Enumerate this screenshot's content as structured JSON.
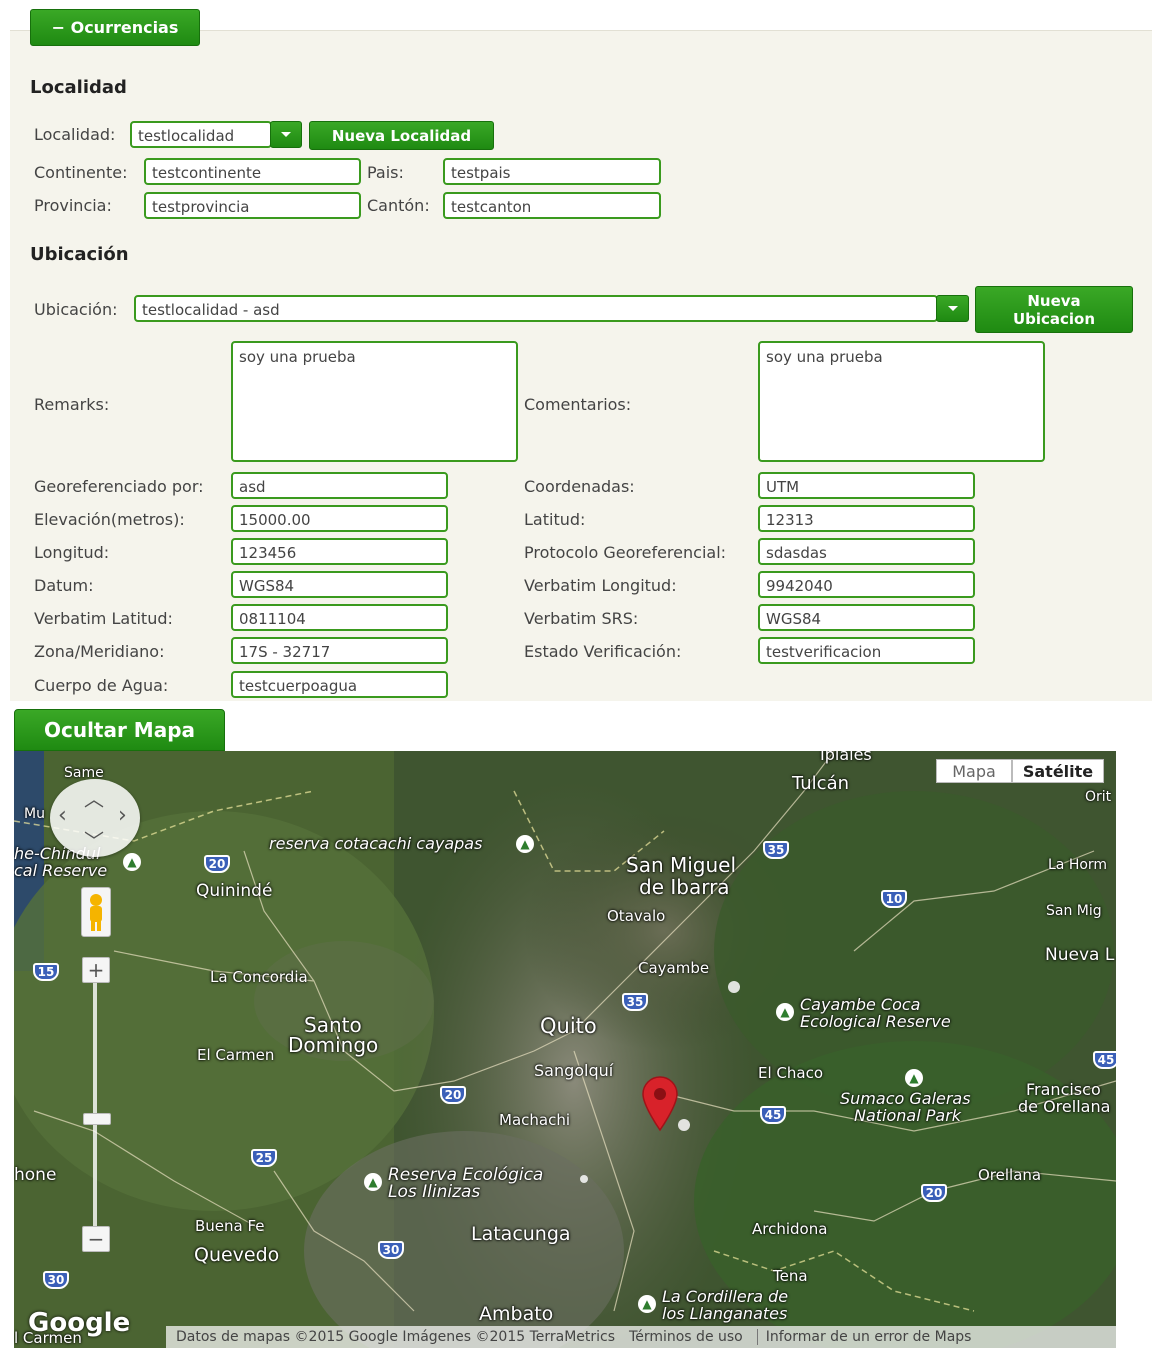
{
  "panel": {
    "toggle_label": "− Ocurrencias"
  },
  "localidad": {
    "title": "Localidad",
    "localidad_label": "Localidad:",
    "localidad_value": "testlocalidad",
    "nueva_localidad_button": "Nueva Localidad",
    "continente_label": "Continente:",
    "continente_value": "testcontinente",
    "pais_label": "Pais:",
    "pais_value": "testpais",
    "provincia_label": "Provincia:",
    "provincia_value": "testprovincia",
    "canton_label": "Cantón:",
    "canton_value": "testcanton"
  },
  "ubicacion": {
    "title": "Ubicación",
    "ubicacion_label": "Ubicación:",
    "ubicacion_value": "testlocalidad - asd",
    "nueva_ubicacion_button_line1": "Nueva",
    "nueva_ubicacion_button_line2": "Ubicacion",
    "remarks_label": "Remarks:",
    "remarks_value": "soy una prueba",
    "comentarios_label": "Comentarios:",
    "comentarios_value": "soy una prueba",
    "left_fields": [
      {
        "label": "Georeferenciado por:",
        "value": "asd"
      },
      {
        "label": "Elevación(metros):",
        "value": "15000.00"
      },
      {
        "label": "Longitud:",
        "value": "123456"
      },
      {
        "label": "Datum:",
        "value": "WGS84"
      },
      {
        "label": "Verbatim Latitud:",
        "value": "0811104"
      },
      {
        "label": "Zona/Meridiano:",
        "value": "17S - 32717"
      },
      {
        "label": "Cuerpo de Agua:",
        "value": "testcuerpoagua"
      }
    ],
    "right_fields": [
      {
        "label": "Coordenadas:",
        "value": "UTM"
      },
      {
        "label": "Latitud:",
        "value": "12313"
      },
      {
        "label": "Protocolo Georeferencial:",
        "value": "sdasdas"
      },
      {
        "label": "Verbatim Longitud:",
        "value": "9942040"
      },
      {
        "label": "Verbatim SRS:",
        "value": "WGS84"
      },
      {
        "label": "Estado Verificación:",
        "value": "testverificacion"
      }
    ]
  },
  "map": {
    "toggle_button": "Ocultar Mapa",
    "type_map": "Mapa",
    "type_satellite": "Satélite",
    "places": [
      {
        "text": "Ipiales"
      },
      {
        "text": "Tulcán"
      },
      {
        "text": "Same"
      },
      {
        "text": "Mu"
      },
      {
        "text": "Orit"
      },
      {
        "text": "reserva cotacachi cayapas"
      },
      {
        "text": "he-Chindul"
      },
      {
        "text": "cal Reserve"
      },
      {
        "text": "Quinindé"
      },
      {
        "text": "San Miguel"
      },
      {
        "text": "de Ibarra"
      },
      {
        "text": "La Horm"
      },
      {
        "text": "San Mig"
      },
      {
        "text": "Otavalo"
      },
      {
        "text": "Nueva L"
      },
      {
        "text": "Cayambe"
      },
      {
        "text": "La Concordia"
      },
      {
        "text": "Cayambe Coca"
      },
      {
        "text": "Ecological Reserve"
      },
      {
        "text": "Santo"
      },
      {
        "text": "Domingo"
      },
      {
        "text": "Quito"
      },
      {
        "text": "El Carmen"
      },
      {
        "text": "Sangolquí"
      },
      {
        "text": "El Chaco"
      },
      {
        "text": "Francisco"
      },
      {
        "text": "de Orellana"
      },
      {
        "text": "Sumaco Galeras"
      },
      {
        "text": "National Park"
      },
      {
        "text": "Machachi"
      },
      {
        "text": "hone"
      },
      {
        "text": "Orellana"
      },
      {
        "text": "Reserva Ecológica"
      },
      {
        "text": "Los Ilinizas"
      },
      {
        "text": "Buena Fe"
      },
      {
        "text": "Archidona"
      },
      {
        "text": "Quevedo"
      },
      {
        "text": "Latacunga"
      },
      {
        "text": "Tena"
      },
      {
        "text": "La Cordillera de"
      },
      {
        "text": "los Llanganates"
      },
      {
        "text": "Ambato"
      },
      {
        "text": "l Carmen"
      }
    ],
    "shields": [
      "20",
      "35",
      "10",
      "15",
      "35",
      "45",
      "20",
      "45",
      "25",
      "20",
      "30",
      "30"
    ],
    "logo": "Google",
    "attribution": "Datos de mapas ©2015 Google Imágenes ©2015 TerraMetrics",
    "terms": "Términos de uso",
    "report": "Informar de un error de Maps",
    "colors": {
      "marker": "#d8222a",
      "shield": "#3a5fb8",
      "green_button": "#2a9a1a"
    }
  }
}
